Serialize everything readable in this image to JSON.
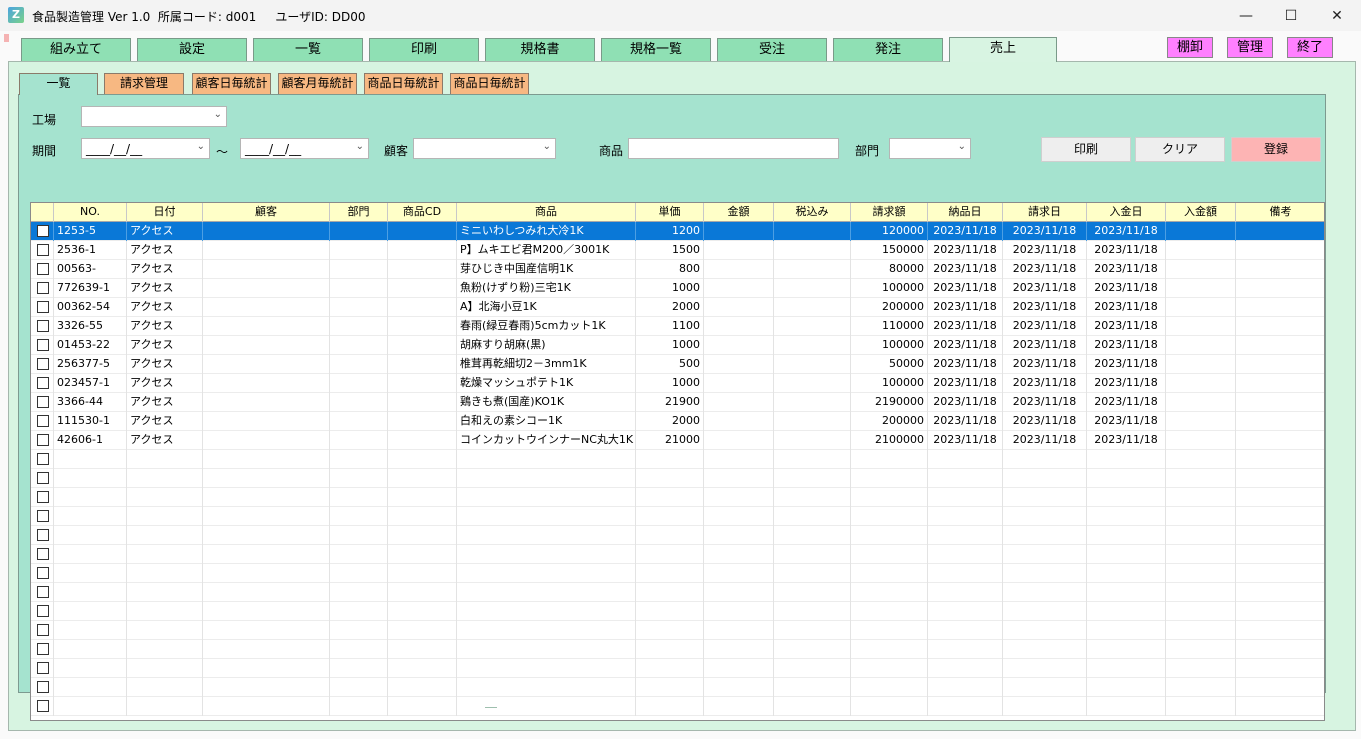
{
  "window": {
    "title": "食品製造管理 Ver 1.0  所属コード: d001     ユーザID: DD00",
    "icon": "app-z-icon"
  },
  "main_tabs": [
    "組み立て",
    "設定",
    "一覧",
    "印刷",
    "規格書",
    "規格一覧",
    "受注",
    "発注",
    "売上"
  ],
  "main_tabs_active": "売上",
  "top_buttons": {
    "shelf": "棚卸",
    "admin": "管理",
    "exit": "終了"
  },
  "sub_tabs": [
    "一覧",
    "請求管理",
    "顧客日毎統計",
    "顧客月毎統計",
    "商品日毎統計",
    "商品日毎統計"
  ],
  "sub_tabs_active": "一覧",
  "filters": {
    "factory_label": "工場",
    "factory_value": "",
    "period_label": "期間",
    "date_from": "____/__/__",
    "date_tilde": "～",
    "date_to": "____/__/__",
    "customer_label": "顧客",
    "customer_value": "",
    "product_label": "商品",
    "product_value": "",
    "dept_label": "部門",
    "dept_value": ""
  },
  "actions": {
    "print": "印刷",
    "clear": "クリア",
    "register": "登録"
  },
  "grid": {
    "headers": [
      "",
      "NO.",
      "日付",
      "顧客",
      "部門",
      "商品CD",
      "商品",
      "単価",
      "金額",
      "税込み",
      "請求額",
      "納品日",
      "請求日",
      "入金日",
      "入金額",
      "備考"
    ],
    "rows": [
      {
        "no": "1253-5",
        "date": "アクセス",
        "product": "ミニいわしつみれ大冷1K",
        "price": "1200",
        "billing": "120000",
        "delivery": "2023/11/18",
        "bill_date": "2023/11/18",
        "pay_date": "2023/11/18"
      },
      {
        "no": "2536-1",
        "date": "アクセス",
        "product": "P】ムキエビ君M200／3001K",
        "price": "1500",
        "billing": "150000",
        "delivery": "2023/11/18",
        "bill_date": "2023/11/18",
        "pay_date": "2023/11/18"
      },
      {
        "no": "00563-",
        "date": "アクセス",
        "product": "芽ひじき中国産信明1K",
        "price": "800",
        "billing": "80000",
        "delivery": "2023/11/18",
        "bill_date": "2023/11/18",
        "pay_date": "2023/11/18"
      },
      {
        "no": "772639-1",
        "date": "アクセス",
        "product": "魚粉(けずり粉)三宅1K",
        "price": "1000",
        "billing": "100000",
        "delivery": "2023/11/18",
        "bill_date": "2023/11/18",
        "pay_date": "2023/11/18"
      },
      {
        "no": "00362-54",
        "date": "アクセス",
        "product": "A】北海小豆1K",
        "price": "2000",
        "billing": "200000",
        "delivery": "2023/11/18",
        "bill_date": "2023/11/18",
        "pay_date": "2023/11/18"
      },
      {
        "no": "3326-55",
        "date": "アクセス",
        "product": "春雨(緑豆春雨)5cmカット1K",
        "price": "1100",
        "billing": "110000",
        "delivery": "2023/11/18",
        "bill_date": "2023/11/18",
        "pay_date": "2023/11/18"
      },
      {
        "no": "01453-22",
        "date": "アクセス",
        "product": "胡麻すり胡麻(黒)",
        "price": "1000",
        "billing": "100000",
        "delivery": "2023/11/18",
        "bill_date": "2023/11/18",
        "pay_date": "2023/11/18"
      },
      {
        "no": "256377-5",
        "date": "アクセス",
        "product": "椎茸再乾細切2－3mm1K",
        "price": "500",
        "billing": "50000",
        "delivery": "2023/11/18",
        "bill_date": "2023/11/18",
        "pay_date": "2023/11/18"
      },
      {
        "no": "023457-1",
        "date": "アクセス",
        "product": "乾燥マッシュポテト1K",
        "price": "1000",
        "billing": "100000",
        "delivery": "2023/11/18",
        "bill_date": "2023/11/18",
        "pay_date": "2023/11/18"
      },
      {
        "no": "3366-44",
        "date": "アクセス",
        "product": "鶏きも煮(国産)KO1K",
        "price": "21900",
        "billing": "2190000",
        "delivery": "2023/11/18",
        "bill_date": "2023/11/18",
        "pay_date": "2023/11/18"
      },
      {
        "no": "111530-1",
        "date": "アクセス",
        "product": "白和えの素シコー1K",
        "price": "2000",
        "billing": "200000",
        "delivery": "2023/11/18",
        "bill_date": "2023/11/18",
        "pay_date": "2023/11/18"
      },
      {
        "no": "42606-1",
        "date": "アクセス",
        "product": "コインカットウインナーNC丸大1K",
        "price": "21000",
        "billing": "2100000",
        "delivery": "2023/11/18",
        "bill_date": "2023/11/18",
        "pay_date": "2023/11/18"
      }
    ],
    "selected_row": 0
  },
  "colors": {
    "tab_green": "#8fe0b4",
    "tab_orange": "#f7b882",
    "panel_teal": "#a5e3cf",
    "header_yellow": "#ffffc8",
    "select_blue": "#0a78d7",
    "register_pink": "#fdb4b4",
    "magenta_btn": "#ff80ff"
  }
}
